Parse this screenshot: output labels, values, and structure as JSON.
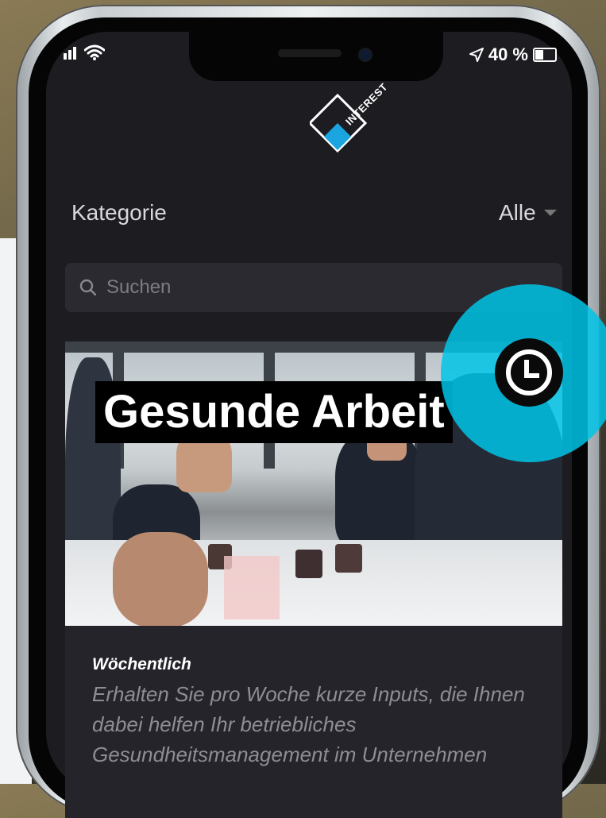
{
  "status": {
    "battery": "40 %"
  },
  "logo": {
    "text": "INTEREST"
  },
  "filter": {
    "label": "Kategorie",
    "value": "Alle"
  },
  "search": {
    "placeholder": "Suchen"
  },
  "card": {
    "title": "Gesunde Arbeit",
    "frequency": "Wöchentlich",
    "description": "Erhalten Sie pro Woche kurze Inputs, die Ihnen dabei helfen Ihr betriebliches Gesundheitsmanagement im Unternehmen"
  },
  "colors": {
    "accent": "#00C4E6",
    "background": "#1D1C21",
    "card": "#25242A"
  },
  "icons": {
    "fab": "clock-icon",
    "search": "search-icon",
    "dropdown": "caret-down-icon",
    "location": "location-arrow-icon"
  }
}
